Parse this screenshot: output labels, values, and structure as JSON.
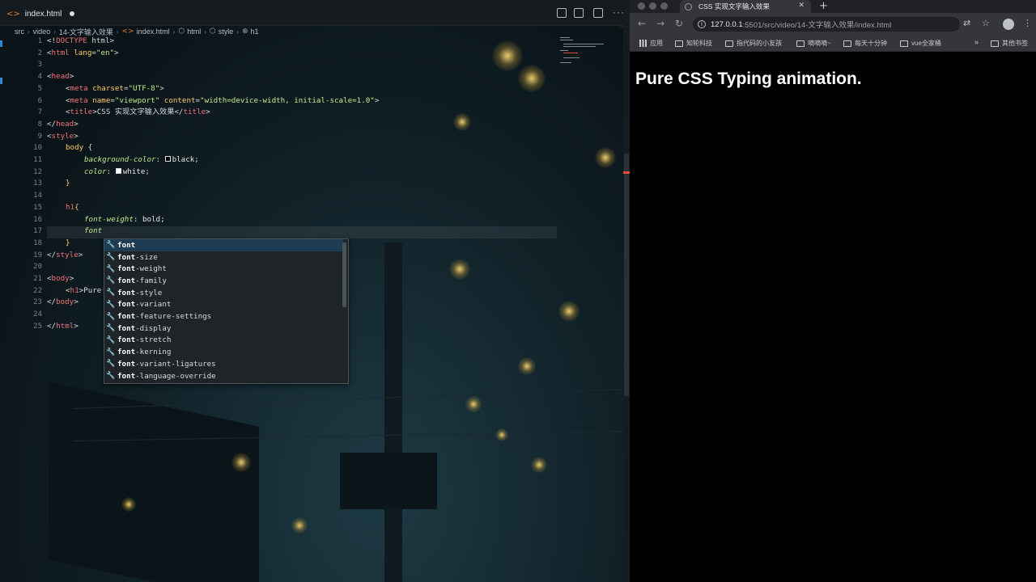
{
  "editor": {
    "tab": {
      "icon": "html-file-icon",
      "label": "index.html"
    },
    "breadcrumb": [
      "src",
      "video",
      "14-文字输入效果",
      "index.html",
      "html",
      "style",
      "h1"
    ],
    "lines": [
      {
        "n": "1"
      },
      {
        "n": "2"
      },
      {
        "n": "3"
      },
      {
        "n": "4"
      },
      {
        "n": "5"
      },
      {
        "n": "6"
      },
      {
        "n": "7"
      },
      {
        "n": "8"
      },
      {
        "n": "9"
      },
      {
        "n": "10"
      },
      {
        "n": "11"
      },
      {
        "n": "12"
      },
      {
        "n": "13"
      },
      {
        "n": "14"
      },
      {
        "n": "15"
      },
      {
        "n": "16"
      },
      {
        "n": "17"
      },
      {
        "n": "18"
      },
      {
        "n": "19"
      },
      {
        "n": "20"
      },
      {
        "n": "21"
      },
      {
        "n": "22"
      },
      {
        "n": "23"
      },
      {
        "n": "24"
      },
      {
        "n": "25"
      }
    ],
    "code": {
      "l1_a": "<!",
      "l1_b": "DOCTYPE",
      "l1_c": " html>",
      "l2_a": "<",
      "l2_b": "html",
      "l2_c": " lang",
      "l2_d": "=",
      "l2_e": "\"en\"",
      "l2_f": ">",
      "l4": "head",
      "l5_tag": "meta",
      "l5_attr": "charset",
      "l5_val": "\"UTF-8\"",
      "l6_tag": "meta",
      "l6_attr1": "name",
      "l6_val1": "\"viewport\"",
      "l6_attr2": "content",
      "l6_val2": "\"width=device-width, initial-scale=1.0\"",
      "l7_tag": "title",
      "l7_text": "CSS 实现文字输入效果",
      "l7_close": "title",
      "l8": "head",
      "l9": "style",
      "l10_sel": "body",
      "l10_brace": " {",
      "l11_prop": "background-color",
      "l11_val": "black",
      "l12_prop": "color",
      "l12_val": "white",
      "l13": "}",
      "l15_sel": "h1",
      "l15_brace": "{",
      "l16_prop": "font-weight",
      "l16_val": "bold;",
      "l17_typed": "font",
      "l18": "}",
      "l19_close": "style",
      "l21": "body",
      "l22_tag": "h1",
      "l22_text": "Pure",
      "l23": "body",
      "l25": "html"
    },
    "suggestions": [
      {
        "match": "font",
        "rest": ""
      },
      {
        "match": "font",
        "rest": "-size"
      },
      {
        "match": "font",
        "rest": "-weight"
      },
      {
        "match": "font",
        "rest": "-family"
      },
      {
        "match": "font",
        "rest": "-style"
      },
      {
        "match": "font",
        "rest": "-variant"
      },
      {
        "match": "font",
        "rest": "-feature-settings"
      },
      {
        "match": "font",
        "rest": "-display"
      },
      {
        "match": "font",
        "rest": "-stretch"
      },
      {
        "match": "font",
        "rest": "-kerning"
      },
      {
        "match": "font",
        "rest": "-variant-ligatures"
      },
      {
        "match": "font",
        "rest": "-language-override"
      }
    ]
  },
  "browser": {
    "tab_title": "CSS 实现文字输入效果",
    "url_host": "127.0.0.1",
    "url_rest": ":5501/src/video/14-文字输入效果/index.html",
    "bookmarks": [
      "应用",
      "知轮科技",
      "指代码的小友孩",
      "嘀嘀嘀~",
      "每天十分钟",
      "vue全家桶",
      "其他书签"
    ],
    "page_heading": "Pure CSS Typing animation."
  },
  "colors": {
    "accent_tag": "#f07178",
    "accent_string": "#c3e88d",
    "accent_attr": "#ffcb6b",
    "page_bg": "#000000",
    "page_text": "#ffffff"
  }
}
